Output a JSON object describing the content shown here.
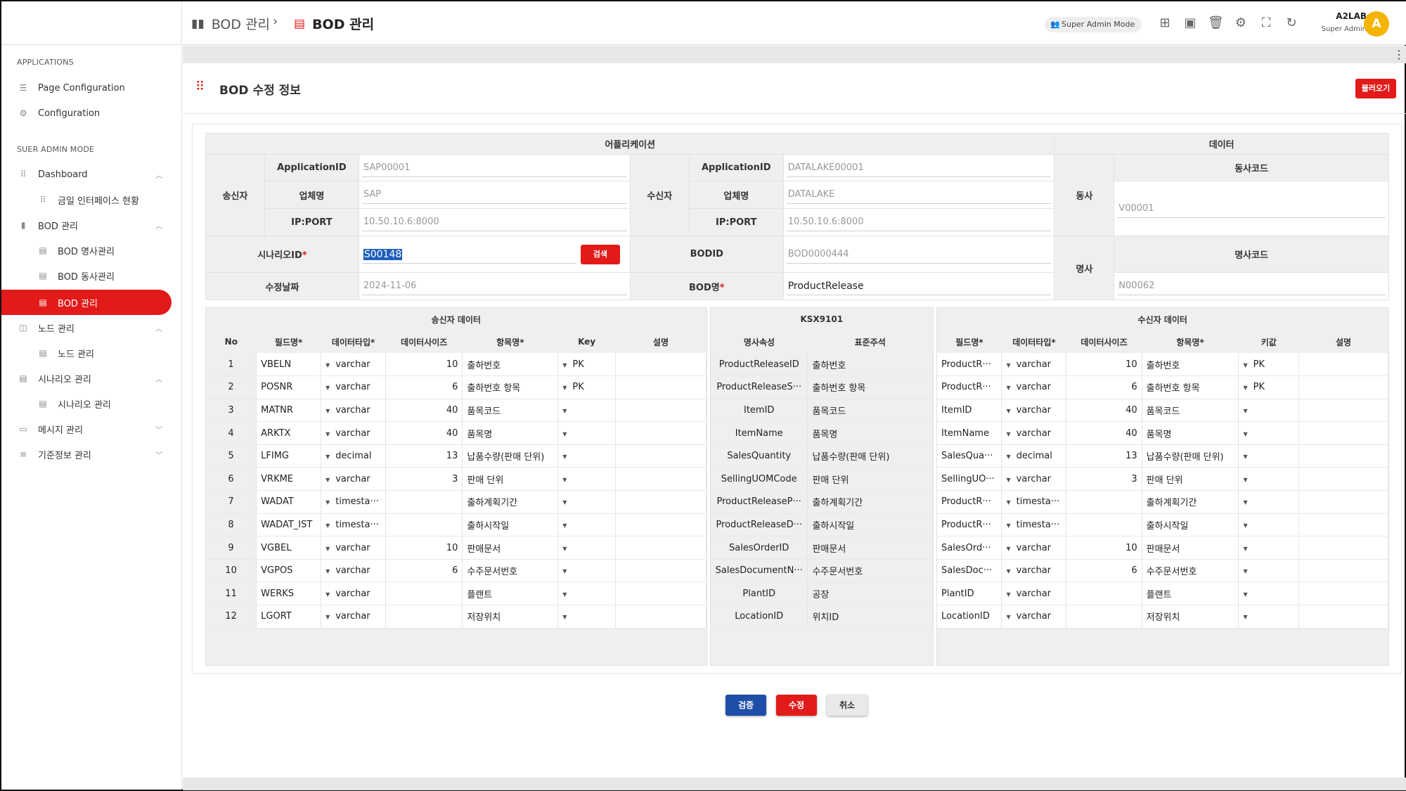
{
  "sidebar": {
    "sections": [
      "APPLICATIONS",
      "SUER ADMIN MODE"
    ],
    "items": [
      {
        "label": "Page Configuration",
        "icon": "sliders-icon"
      },
      {
        "label": "Configuration",
        "icon": "gear-icon"
      },
      {
        "label": "Dashboard",
        "icon": "grid-icon"
      },
      {
        "label": "금일 인터페이스 현황",
        "icon": "grid-icon"
      },
      {
        "label": "BOD 관리",
        "icon": "bar-chart-icon"
      },
      {
        "label": "BOD 명사관리",
        "icon": "document-icon"
      },
      {
        "label": "BOD 동사관리",
        "icon": "document-icon"
      },
      {
        "label": "BOD 관리",
        "icon": "document-icon"
      },
      {
        "label": "노드 관리",
        "icon": "node-icon"
      },
      {
        "label": "노드 관리",
        "icon": "document-icon"
      },
      {
        "label": "시나리오 관리",
        "icon": "document-icon"
      },
      {
        "label": "시나리오 관리",
        "icon": "document-icon"
      },
      {
        "label": "메시지 관리",
        "icon": "message-icon"
      },
      {
        "label": "기준정보 관리",
        "icon": "list-icon"
      }
    ]
  },
  "topbar": {
    "breadcrumb1": "BOD 관리",
    "breadcrumb2": "BOD 관리",
    "mode": "Super Admin Mode",
    "user_name": "A2LAB",
    "user_role": "Super Admin",
    "avatar": "A"
  },
  "page": {
    "title": "BOD 수정 정보",
    "load_button": "불러오기"
  },
  "info": {
    "app_header": "어플리케이션",
    "data_header": "데이터",
    "sender_label": "송신자",
    "receiver_label": "수신자",
    "appid_label": "ApplicationID",
    "company_label": "업체명",
    "ipport_label": "IP:PORT",
    "sender": {
      "appid": "SAP00001",
      "company": "SAP",
      "ipport": "10.50.10.6:8000"
    },
    "receiver": {
      "appid": "DATALAKE00001",
      "company": "DATALAKE",
      "ipport": "10.50.10.6:8000"
    },
    "verb_label": "동사",
    "verb_code_label": "동사코드",
    "verb_code": "V00001",
    "noun_label": "명사",
    "noun_code_label": "명사코드",
    "noun_code": "N00062",
    "scenario_label": "시나리오ID",
    "scenario_value": "S00148",
    "search_button": "검색",
    "bodid_label": "BODID",
    "bodid_value": "BOD0000444",
    "date_label": "수정날짜",
    "date_value": "2024-11-06",
    "bodname_label": "BOD명",
    "bodname_value": "ProductRelease",
    "required_mark": "*"
  },
  "grid": {
    "sender_title": "송신자 데이터",
    "ksx_title": "KSX9101",
    "receiver_title": "수신자 데이터",
    "sender_cols": [
      "No",
      "필드명*",
      "데이터타입*",
      "데이터사이즈",
      "항목명*",
      "Key",
      "설명"
    ],
    "ksx_cols": [
      "명사속성",
      "표준주석"
    ],
    "receiver_cols": [
      "필드명*",
      "데이터타입*",
      "데이터사이즈",
      "항목명*",
      "키값",
      "설명"
    ],
    "rows": [
      {
        "no": "1",
        "s_field": "VBELN",
        "s_type": "varchar",
        "s_size": "10",
        "s_item": "출하번호",
        "s_key": "PK",
        "k_attr": "ProductReleaseID",
        "k_note": "출하번호",
        "r_field": "ProductR···",
        "r_type": "varchar",
        "r_size": "10",
        "r_item": "출하번호",
        "r_key": "PK"
      },
      {
        "no": "2",
        "s_field": "POSNR",
        "s_type": "varchar",
        "s_size": "6",
        "s_item": "출하번호 항목",
        "s_key": "PK",
        "k_attr": "ProductReleaseS···",
        "k_note": "출하번호 항목",
        "r_field": "ProductR···",
        "r_type": "varchar",
        "r_size": "6",
        "r_item": "출하번호 항목",
        "r_key": "PK"
      },
      {
        "no": "3",
        "s_field": "MATNR",
        "s_type": "varchar",
        "s_size": "40",
        "s_item": "품목코드",
        "s_key": "",
        "k_attr": "ItemID",
        "k_note": "품목코드",
        "r_field": "ItemID",
        "r_type": "varchar",
        "r_size": "40",
        "r_item": "품목코드",
        "r_key": ""
      },
      {
        "no": "4",
        "s_field": "ARKTX",
        "s_type": "varchar",
        "s_size": "40",
        "s_item": "품목명",
        "s_key": "",
        "k_attr": "ItemName",
        "k_note": "품목명",
        "r_field": "ItemName",
        "r_type": "varchar",
        "r_size": "40",
        "r_item": "품목명",
        "r_key": ""
      },
      {
        "no": "5",
        "s_field": "LFIMG",
        "s_type": "decimal",
        "s_size": "13",
        "s_item": "납품수량(판매 단위)",
        "s_key": "",
        "k_attr": "SalesQuantity",
        "k_note": "납품수량(판매 단위)",
        "r_field": "SalesQua···",
        "r_type": "decimal",
        "r_size": "13",
        "r_item": "납품수량(판매 단위)",
        "r_key": ""
      },
      {
        "no": "6",
        "s_field": "VRKME",
        "s_type": "varchar",
        "s_size": "3",
        "s_item": "판매 단위",
        "s_key": "",
        "k_attr": "SellingUOMCode",
        "k_note": "판매 단위",
        "r_field": "SellingUO···",
        "r_type": "varchar",
        "r_size": "3",
        "r_item": "판매 단위",
        "r_key": ""
      },
      {
        "no": "7",
        "s_field": "WADAT",
        "s_type": "timesta···",
        "s_size": "",
        "s_item": "출하계획기간",
        "s_key": "",
        "k_attr": "ProductReleaseP···",
        "k_note": "출하계획기간",
        "r_field": "ProductR···",
        "r_type": "timesta···",
        "r_size": "",
        "r_item": "출하계획기간",
        "r_key": ""
      },
      {
        "no": "8",
        "s_field": "WADAT_IST",
        "s_type": "timesta···",
        "s_size": "",
        "s_item": "출하시작일",
        "s_key": "",
        "k_attr": "ProductReleaseD···",
        "k_note": "출하시작일",
        "r_field": "ProductR···",
        "r_type": "timesta···",
        "r_size": "",
        "r_item": "출하시작일",
        "r_key": ""
      },
      {
        "no": "9",
        "s_field": "VGBEL",
        "s_type": "varchar",
        "s_size": "10",
        "s_item": "판매문서",
        "s_key": "",
        "k_attr": "SalesOrderID",
        "k_note": "판매문서",
        "r_field": "SalesOrd···",
        "r_type": "varchar",
        "r_size": "10",
        "r_item": "판매문서",
        "r_key": ""
      },
      {
        "no": "10",
        "s_field": "VGPOS",
        "s_type": "varchar",
        "s_size": "6",
        "s_item": "수주문서번호",
        "s_key": "",
        "k_attr": "SalesDocumentN···",
        "k_note": "수주문서번호",
        "r_field": "SalesDoc···",
        "r_type": "varchar",
        "r_size": "6",
        "r_item": "수주문서번호",
        "r_key": ""
      },
      {
        "no": "11",
        "s_field": "WERKS",
        "s_type": "varchar",
        "s_size": "",
        "s_item": "플랜트",
        "s_key": "",
        "k_attr": "PlantID",
        "k_note": "공장",
        "r_field": "PlantID",
        "r_type": "varchar",
        "r_size": "",
        "r_item": "플랜트",
        "r_key": ""
      },
      {
        "no": "12",
        "s_field": "LGORT",
        "s_type": "varchar",
        "s_size": "",
        "s_item": "저장위치",
        "s_key": "",
        "k_attr": "LocationID",
        "k_note": "위치ID",
        "r_field": "LocationID",
        "r_type": "varchar",
        "r_size": "",
        "r_item": "저장위치",
        "r_key": ""
      }
    ]
  },
  "footer": {
    "validate": "검증",
    "modify": "수정",
    "cancel": "취소"
  },
  "colors": {
    "accent": "#e21a1a",
    "blue": "#1e4fa8",
    "avatar": "#f5b400"
  }
}
